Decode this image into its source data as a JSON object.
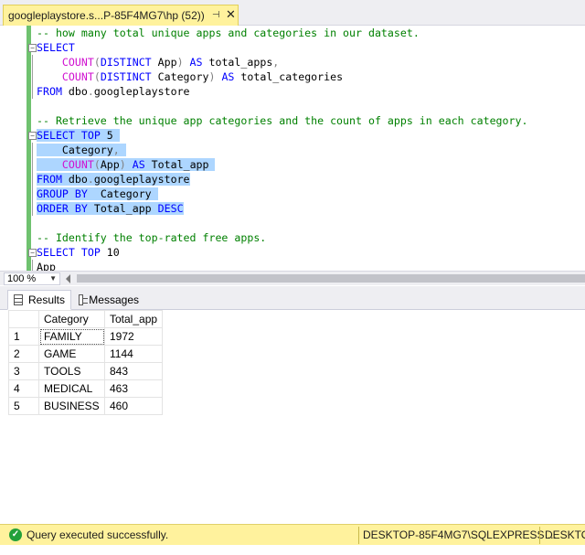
{
  "document_tab": {
    "title": "googleplaystore.s...P-85F4MG7\\hp (52))",
    "pin_icon": "pin-icon",
    "close_icon": "close-icon"
  },
  "editor": {
    "lines": [
      {
        "tokens": [
          {
            "t": "-- how many total unique apps and categories in our dataset.",
            "c": "com"
          }
        ]
      },
      {
        "fold": "minus",
        "tokens": [
          {
            "t": "SELECT",
            "c": "kw"
          }
        ]
      },
      {
        "tokens": [
          {
            "t": "    ",
            "c": "txt"
          },
          {
            "t": "COUNT",
            "c": "fn"
          },
          {
            "t": "(",
            "c": "gray"
          },
          {
            "t": "DISTINCT",
            "c": "kw"
          },
          {
            "t": " App",
            "c": "txt"
          },
          {
            "t": ")",
            "c": "gray"
          },
          {
            "t": " AS",
            "c": "kw"
          },
          {
            "t": " total_apps",
            "c": "txt"
          },
          {
            "t": ",",
            "c": "gray"
          }
        ]
      },
      {
        "tokens": [
          {
            "t": "    ",
            "c": "txt"
          },
          {
            "t": "COUNT",
            "c": "fn"
          },
          {
            "t": "(",
            "c": "gray"
          },
          {
            "t": "DISTINCT",
            "c": "kw"
          },
          {
            "t": " Category",
            "c": "txt"
          },
          {
            "t": ")",
            "c": "gray"
          },
          {
            "t": " AS",
            "c": "kw"
          },
          {
            "t": " total_categories",
            "c": "txt"
          }
        ]
      },
      {
        "tokens": [
          {
            "t": "FROM",
            "c": "kw"
          },
          {
            "t": " dbo",
            "c": "txt"
          },
          {
            "t": ".",
            "c": "gray"
          },
          {
            "t": "googleplaystore",
            "c": "txt"
          }
        ]
      },
      {
        "tokens": []
      },
      {
        "tokens": [
          {
            "t": "-- Retrieve the unique app categories and the count of apps in each category.",
            "c": "com"
          }
        ]
      },
      {
        "fold": "minus",
        "hl": true,
        "tokens": [
          {
            "t": "SELECT",
            "c": "kw"
          },
          {
            "t": " TOP",
            "c": "kw"
          },
          {
            "t": " 5",
            "c": "txt"
          },
          {
            "t": " ",
            "c": "txt"
          }
        ]
      },
      {
        "hl": true,
        "tokens": [
          {
            "t": "    Category",
            "c": "txt"
          },
          {
            "t": ",",
            "c": "gray"
          },
          {
            "t": " ",
            "c": "txt"
          }
        ]
      },
      {
        "hl": true,
        "tokens": [
          {
            "t": "    ",
            "c": "txt"
          },
          {
            "t": "COUNT",
            "c": "fn"
          },
          {
            "t": "(",
            "c": "gray"
          },
          {
            "t": "App",
            "c": "txt"
          },
          {
            "t": ")",
            "c": "gray"
          },
          {
            "t": " AS",
            "c": "kw"
          },
          {
            "t": " Total_app ",
            "c": "txt"
          }
        ]
      },
      {
        "hl": true,
        "tokens": [
          {
            "t": "FROM",
            "c": "kw"
          },
          {
            "t": " dbo",
            "c": "txt"
          },
          {
            "t": ".",
            "c": "gray"
          },
          {
            "t": "googleplaystore",
            "c": "txt"
          }
        ]
      },
      {
        "hl": true,
        "tokens": [
          {
            "t": "GROUP",
            "c": "kw"
          },
          {
            "t": " BY",
            "c": "kw"
          },
          {
            "t": "  Category ",
            "c": "txt"
          }
        ]
      },
      {
        "hl": true,
        "tokens": [
          {
            "t": "ORDER",
            "c": "kw"
          },
          {
            "t": " BY",
            "c": "kw"
          },
          {
            "t": " Total_app",
            "c": "txt"
          },
          {
            "t": " DESC",
            "c": "kw"
          }
        ]
      },
      {
        "tokens": []
      },
      {
        "tokens": [
          {
            "t": "-- Identify the top-rated free apps.",
            "c": "com"
          }
        ]
      },
      {
        "fold": "minus",
        "tokens": [
          {
            "t": "SELECT",
            "c": "kw"
          },
          {
            "t": " TOP",
            "c": "kw"
          },
          {
            "t": " 10",
            "c": "txt"
          }
        ]
      },
      {
        "tokens": [
          {
            "t": "App",
            "c": "txt"
          }
        ]
      }
    ]
  },
  "zoom": {
    "value": "100 %"
  },
  "result_tabs": {
    "results_label": "Results",
    "messages_label": "Messages"
  },
  "results": {
    "columns": [
      "Category",
      "Total_app"
    ],
    "rows": [
      {
        "n": "1",
        "category": "FAMILY",
        "total": "1972"
      },
      {
        "n": "2",
        "category": "GAME",
        "total": "1144"
      },
      {
        "n": "3",
        "category": "TOOLS",
        "total": "843"
      },
      {
        "n": "4",
        "category": "MEDICAL",
        "total": "463"
      },
      {
        "n": "5",
        "category": "BUSINESS",
        "total": "460"
      }
    ]
  },
  "status_bar": {
    "message": "Query executed successfully.",
    "server": "DESKTOP-85F4MG7\\SQLEXPRESS ...",
    "server_short": "DESKTOP"
  }
}
